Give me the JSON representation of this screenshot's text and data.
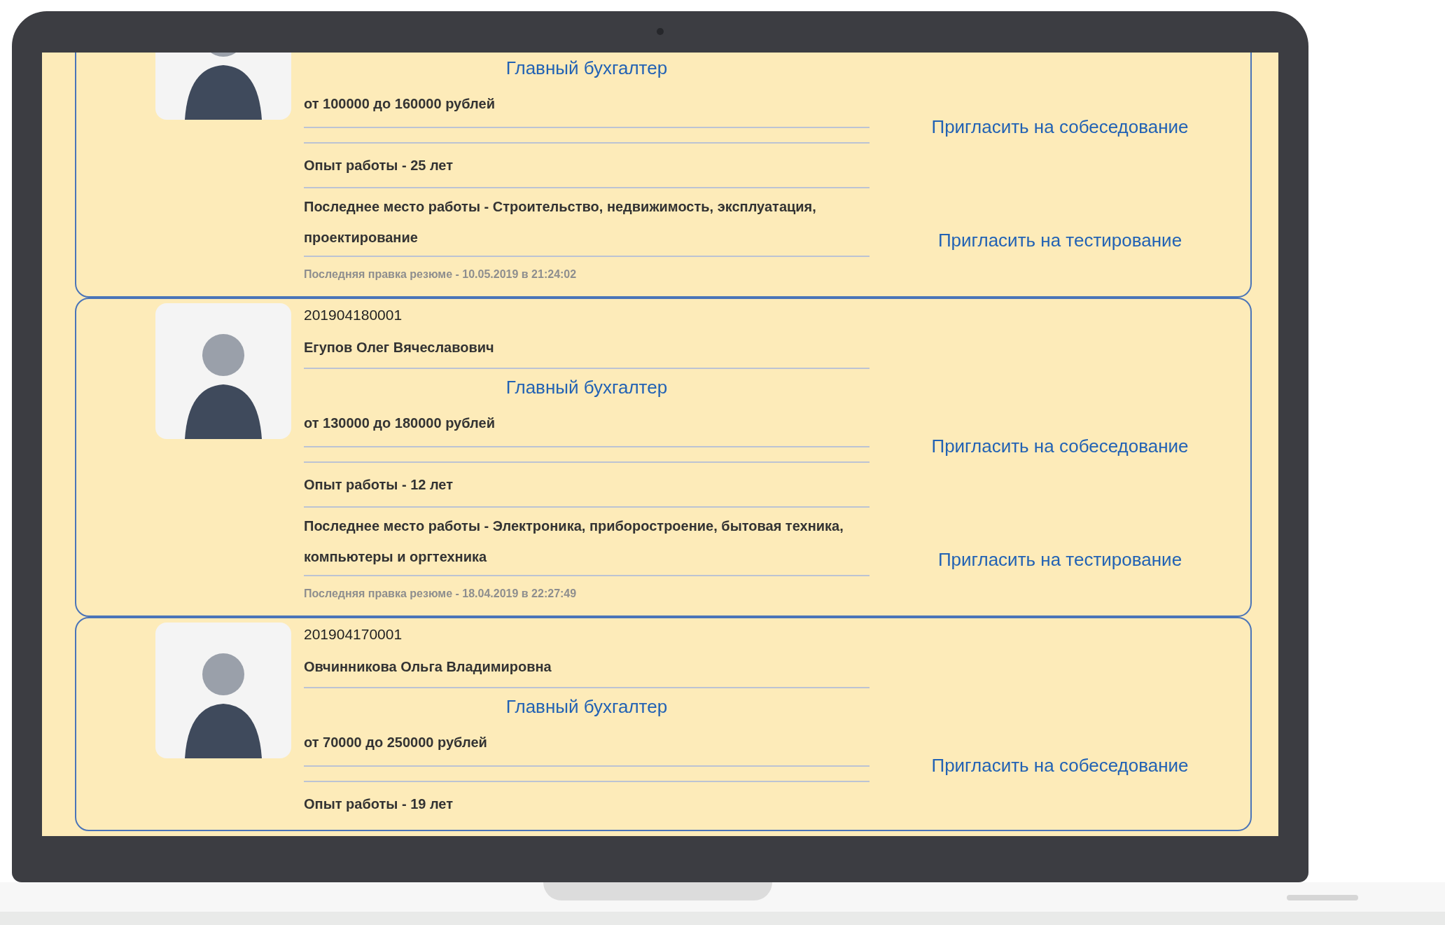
{
  "cards": [
    {
      "position": "Главный бухгалтер",
      "salary": "от 100000 до 160000 рублей",
      "experience": "Опыт работы - 25 лет",
      "last_job": "Последнее место работы - Строительство, недвижимость, эксплуатация, проектирование",
      "edited": "Последняя правка резюме - 10.05.2019 в 21:24:02",
      "actions": [
        "Пригласить на собеседование",
        "Пригласить на тестирование"
      ]
    },
    {
      "id": "201904180001",
      "name": "Егупов Олег Вячеславович",
      "position": "Главный бухгалтер",
      "salary": "от 130000 до 180000 рублей",
      "experience": "Опыт работы - 12 лет",
      "last_job": "Последнее место работы - Электроника, приборостроение, бытовая техника, компьютеры и оргтехника",
      "edited": "Последняя правка резюме - 18.04.2019 в 22:27:49",
      "actions": [
        "Пригласить на собеседование",
        "Пригласить на тестирование"
      ]
    },
    {
      "id": "201904170001",
      "name": "Овчинникова Ольга Владимировна",
      "position": "Главный бухгалтер",
      "salary": "от 70000 до 250000 рублей",
      "experience": "Опыт работы - 19 лет",
      "actions": [
        "Пригласить на собеседование"
      ]
    }
  ]
}
